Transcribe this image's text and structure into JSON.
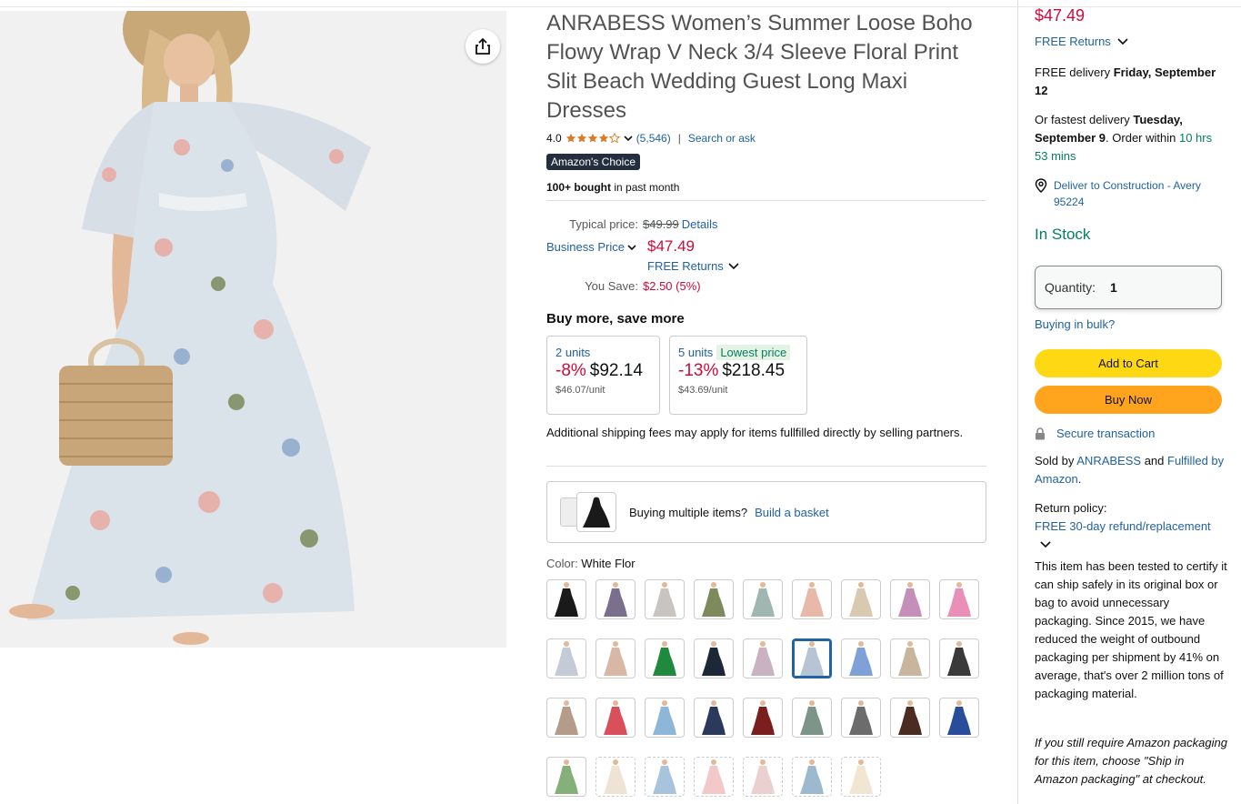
{
  "product": {
    "title": "ANRABESS Women’s Summer Loose Boho Flowy Wrap V Neck 3/4 Sleeve Floral Print Slit Beach Wedding Guest Long Maxi Dresses",
    "rating": "4.0",
    "rating_value": 4.0,
    "review_count": "(5,546)",
    "search_or_ask": "Search or ask",
    "badge": "Amazon's Choice",
    "bought_bold": "100+ bought",
    "bought_rest": " in past month"
  },
  "pricing": {
    "typical_label": "Typical price:",
    "typical_value": "$49.99",
    "details_link": "Details",
    "business_price_label": "Business Price",
    "price": "$47.49",
    "free_returns": "FREE Returns",
    "you_save_label": "You Save:",
    "you_save_value": "$2.50 (5%)"
  },
  "buy_more": {
    "title": "Buy more, save more",
    "tiers": [
      {
        "units": "2 units",
        "lowest": "",
        "pct": "-8%",
        "amount": "$92.14",
        "per_unit": "$46.07/unit"
      },
      {
        "units": "5 units",
        "lowest": "Lowest price",
        "pct": "-13%",
        "amount": "$218.45",
        "per_unit": "$43.69/unit"
      }
    ],
    "shipping_note": "Additional shipping fees may apply for items fullfilled directly by selling partners."
  },
  "basket": {
    "text": "Buying multiple items?",
    "link": "Build a basket"
  },
  "color": {
    "label": "Color: ",
    "selected": "White Flor",
    "swatch_colors": [
      [
        "#1a1a1a",
        "#7a6f8c",
        "#c9c4bf",
        "#7d8a5e",
        "#9fb7b0",
        "#e8b9a9",
        "#d9c9b0",
        "#c58fb9",
        "#ea8fb8"
      ],
      [
        "#c4cbd7",
        "#d8b8a5",
        "#1f8a3e",
        "#1c2838",
        "#c9b3c2",
        "#b7c4d6",
        "#7fa1d8",
        "#c9b49e",
        "#3a3a3a"
      ],
      [
        "#b59b8a",
        "#d9505b",
        "#8db6d8",
        "#2b3a5c",
        "#7a1e1e",
        "#7d9488",
        "#6c6c6c",
        "#4a2c20",
        "#284d9a"
      ],
      [
        "#86b07a",
        "#efe3d6",
        "#a8c4dc",
        "#f2c8c8",
        "#ead0cf",
        "#9cb9cf",
        "#f0e6d2"
      ]
    ]
  },
  "buybox": {
    "price": "$47.49",
    "free_returns": "FREE Returns",
    "delivery_prefix": "FREE delivery ",
    "delivery_date": "Friday, September 12",
    "fastest_prefix": "Or fastest delivery ",
    "fastest_date": "Tuesday, September 9",
    "order_within_prefix": ". Order within ",
    "order_within": "10 hrs 53 mins",
    "deliver_to": "Deliver to Construction - Avery 95224",
    "stock": "In Stock",
    "quantity_label": "Quantity:",
    "quantity_value": "1",
    "bulk": "Buying in bulk?",
    "add_to_cart": "Add to Cart",
    "buy_now": "Buy Now",
    "secure": "Secure transaction",
    "sold_by_prefix": "Sold by ",
    "seller": "ANRABESS",
    "and": " and ",
    "fulfilled": "Fulfilled by Amazon",
    "period": ".",
    "return_policy_label": "Return policy:",
    "return_policy_link": "FREE 30-day refund/replacement",
    "tested_text": "This item has been tested to certify it can ship safely in its original box or bag to avoid unnecessary packaging. Since 2015, we have reduced the weight of outbound packaging per shipment by 41% on average, that's over 2 million tons of packaging material.",
    "italic_text": "If you still require Amazon packaging for this item, choose \"Ship in Amazon packaging\" at checkout."
  },
  "colors": {
    "accent_link": "#2162a1",
    "price_red": "#cc0c39",
    "instock_green": "#067d62",
    "cart_yellow": "#ffd814",
    "buy_orange": "#ffa41c",
    "star_orange": "#de7921",
    "badge_navy": "#232f3e"
  },
  "icons": [
    "share-icon",
    "star-icon",
    "chevron-down-icon",
    "location-pin-icon",
    "lock-icon"
  ]
}
